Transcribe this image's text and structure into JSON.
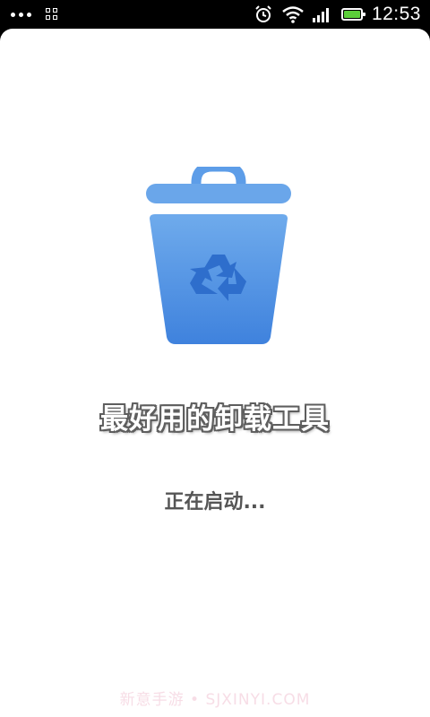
{
  "status_bar": {
    "time": "12:53",
    "icons": [
      "more-dots-icon",
      "grid-icon",
      "alarm-clock-icon",
      "wifi-icon",
      "signal-icon",
      "battery-icon"
    ],
    "battery_color": "#5ccf3a"
  },
  "app": {
    "logo_icon": "recycle-bin-icon",
    "logo_color": "#4a8ee8",
    "title": "最好用的卸载工具",
    "loading": "正在启动..."
  },
  "watermark": "新意手游 • SJXINYI.COM"
}
